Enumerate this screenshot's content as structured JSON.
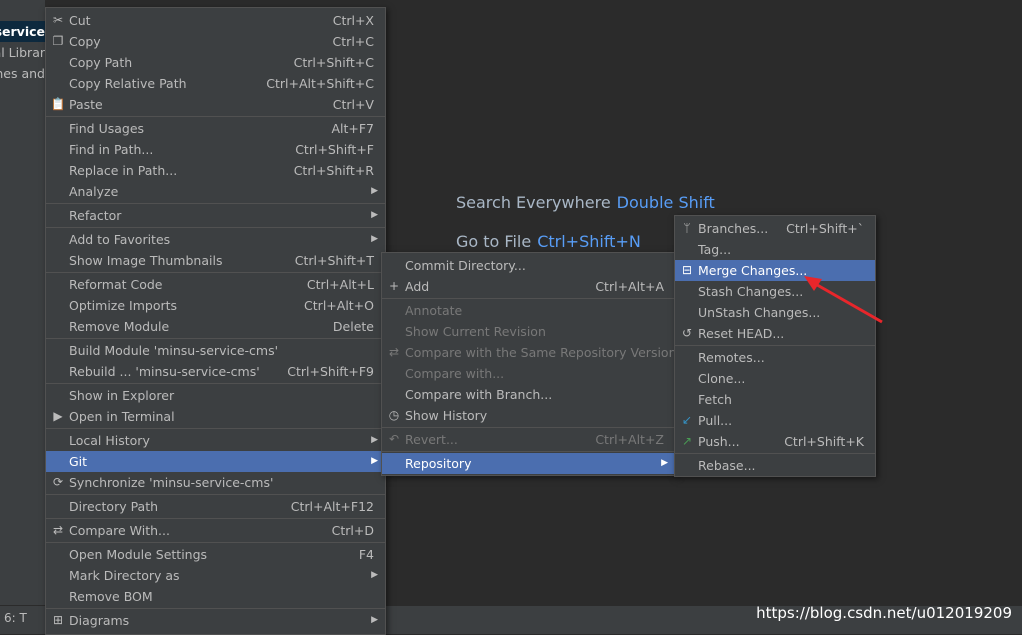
{
  "project": {
    "rows": [
      "-service",
      "al Librar",
      "nes and"
    ]
  },
  "editor": {
    "hints": [
      {
        "label": "Search Everywhere",
        "key": "Double Shift"
      },
      {
        "label": "Go to File",
        "key": "Ctrl+Shift+N"
      }
    ]
  },
  "status_bar": {
    "tab": "6: T"
  },
  "watermark": "https://blog.csdn.net/u012019209",
  "context_menu": {
    "items": [
      {
        "label": "Cut",
        "shortcut": "Ctrl+X",
        "icon": "✂"
      },
      {
        "label": "Copy",
        "shortcut": "Ctrl+C",
        "icon": "❐"
      },
      {
        "label": "Copy Path",
        "shortcut": "Ctrl+Shift+C"
      },
      {
        "label": "Copy Relative Path",
        "shortcut": "Ctrl+Alt+Shift+C"
      },
      {
        "label": "Paste",
        "shortcut": "Ctrl+V",
        "icon": "📋"
      },
      {
        "label": "Find Usages",
        "shortcut": "Alt+F7"
      },
      {
        "label": "Find in Path...",
        "shortcut": "Ctrl+Shift+F"
      },
      {
        "label": "Replace in Path...",
        "shortcut": "Ctrl+Shift+R"
      },
      {
        "label": "Analyze"
      },
      {
        "label": "Refactor"
      },
      {
        "label": "Add to Favorites"
      },
      {
        "label": "Show Image Thumbnails",
        "shortcut": "Ctrl+Shift+T"
      },
      {
        "label": "Reformat Code",
        "shortcut": "Ctrl+Alt+L"
      },
      {
        "label": "Optimize Imports",
        "shortcut": "Ctrl+Alt+O"
      },
      {
        "label": "Remove Module",
        "shortcut": "Delete"
      },
      {
        "label": "Build Module 'minsu-service-cms'"
      },
      {
        "label": "Rebuild ... 'minsu-service-cms'",
        "shortcut": "Ctrl+Shift+F9"
      },
      {
        "label": "Show in Explorer"
      },
      {
        "label": "Open in Terminal",
        "icon": "▶"
      },
      {
        "label": "Local History"
      },
      {
        "label": "Git"
      },
      {
        "label": "Synchronize 'minsu-service-cms'",
        "icon": "⟳"
      },
      {
        "label": "Directory Path",
        "shortcut": "Ctrl+Alt+F12"
      },
      {
        "label": "Compare With...",
        "shortcut": "Ctrl+D",
        "icon": "⇄"
      },
      {
        "label": "Open Module Settings",
        "shortcut": "F4"
      },
      {
        "label": "Mark Directory as"
      },
      {
        "label": "Remove BOM"
      },
      {
        "label": "Diagrams",
        "icon": "⊞"
      }
    ]
  },
  "git_menu": {
    "items": [
      {
        "label": "Commit Directory..."
      },
      {
        "label": "Add",
        "shortcut": "Ctrl+Alt+A",
        "icon": "+"
      },
      {
        "label": "Annotate"
      },
      {
        "label": "Show Current Revision"
      },
      {
        "label": "Compare with the Same Repository Version",
        "icon": "⇄"
      },
      {
        "label": "Compare with..."
      },
      {
        "label": "Compare with Branch..."
      },
      {
        "label": "Show History",
        "icon": "◷"
      },
      {
        "label": "Revert...",
        "shortcut": "Ctrl+Alt+Z",
        "icon": "↶"
      },
      {
        "label": "Repository"
      }
    ]
  },
  "repo_menu": {
    "items": [
      {
        "label": "Branches...",
        "shortcut": "Ctrl+Shift+`",
        "icon": "ᛘ"
      },
      {
        "label": "Tag..."
      },
      {
        "label": "Merge Changes...",
        "icon": "⊟"
      },
      {
        "label": "Stash Changes..."
      },
      {
        "label": "UnStash Changes..."
      },
      {
        "label": "Reset HEAD...",
        "icon": "↺"
      },
      {
        "label": "Remotes..."
      },
      {
        "label": "Clone..."
      },
      {
        "label": "Fetch"
      },
      {
        "label": "Pull...",
        "icon": "↙"
      },
      {
        "label": "Push...",
        "shortcut": "Ctrl+Shift+K",
        "icon": "↗"
      },
      {
        "label": "Rebase..."
      }
    ]
  },
  "colors": {
    "menu_bg": "#3c3f41",
    "selection": "#4b6eaf",
    "annotation_arrow": "#e8262b"
  }
}
